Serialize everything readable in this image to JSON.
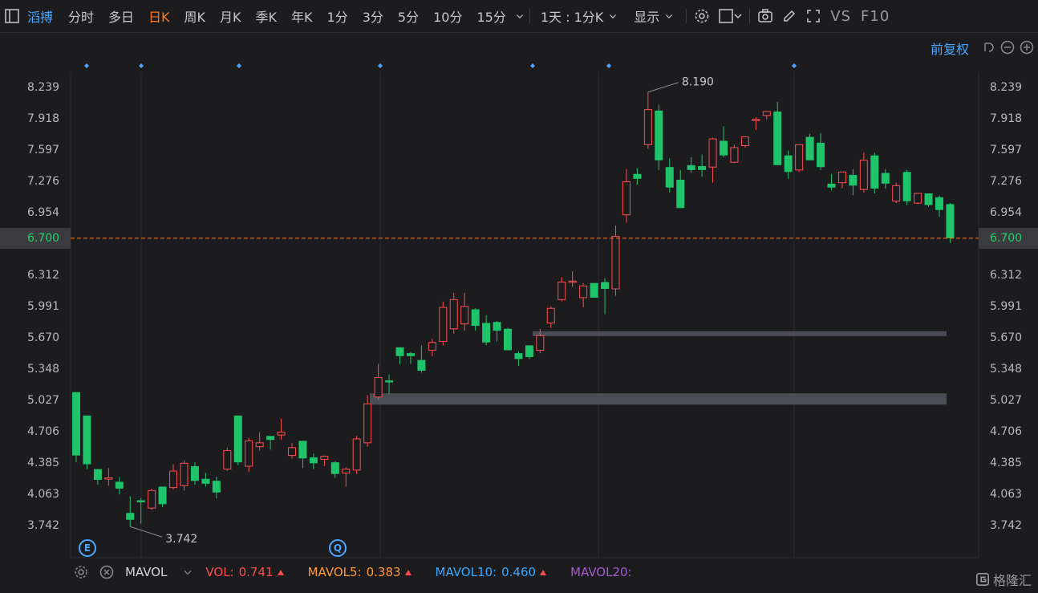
{
  "toolbar": {
    "stock_name": "滔搏",
    "periods": [
      "分时",
      "多日",
      "日K",
      "周K",
      "月K",
      "季K",
      "年K",
      "1分",
      "3分",
      "5分",
      "10分",
      "15分"
    ],
    "active_period": "日K",
    "range_select": "1天 : 1分K",
    "display_label": "显示",
    "vs_label": "VS",
    "f10_label": "F10"
  },
  "header": {
    "restore_label": "前复权"
  },
  "price_axis": {
    "ticks": [
      "8.239",
      "7.918",
      "7.597",
      "7.276",
      "6.954",
      "6.700",
      "6.312",
      "5.991",
      "5.670",
      "5.348",
      "5.027",
      "4.706",
      "4.385",
      "4.063",
      "3.742"
    ],
    "current_price": "6.700"
  },
  "annotations": {
    "high_label": "8.190",
    "low_label": "3.742",
    "event_e": "E",
    "event_q": "Q"
  },
  "indicators": {
    "name": "MAVOL",
    "vol_label": "VOL:",
    "vol_value": "0.741",
    "ma5_label": "MAVOL5:",
    "ma5_value": "0.383",
    "ma10_label": "MAVOL10:",
    "ma10_value": "0.460",
    "ma20_label": "MAVOL20:"
  },
  "colors": {
    "up": "#ff4d4f",
    "down": "#1fc46a",
    "accent": "#ff7a1a",
    "link": "#4da6ff"
  },
  "watermark": "格隆汇",
  "chart_data": {
    "type": "candlestick",
    "ylim": [
      3.742,
      8.239
    ],
    "current_price": 6.7,
    "high": 8.19,
    "low": 3.742,
    "candles": [
      {
        "o": 5.12,
        "h": 5.12,
        "c": 4.47,
        "l": 4.4
      },
      {
        "o": 4.88,
        "h": 4.88,
        "c": 4.38,
        "l": 4.33
      },
      {
        "o": 4.33,
        "h": 4.33,
        "c": 4.22,
        "l": 4.17
      },
      {
        "o": 4.24,
        "h": 4.34,
        "c": 4.24,
        "l": 4.16
      },
      {
        "o": 4.2,
        "h": 4.25,
        "c": 4.13,
        "l": 4.07
      },
      {
        "o": 3.88,
        "h": 4.05,
        "c": 3.81,
        "l": 3.74
      },
      {
        "o": 4.01,
        "h": 4.03,
        "c": 3.99,
        "l": 3.77
      },
      {
        "o": 3.93,
        "h": 4.13,
        "c": 4.11,
        "l": 3.91
      },
      {
        "o": 4.15,
        "h": 4.15,
        "c": 3.97,
        "l": 3.94
      },
      {
        "o": 4.14,
        "h": 4.38,
        "c": 4.31,
        "l": 4.12
      },
      {
        "o": 4.16,
        "h": 4.42,
        "c": 4.39,
        "l": 4.11
      },
      {
        "o": 4.36,
        "h": 4.4,
        "c": 4.21,
        "l": 4.17
      },
      {
        "o": 4.23,
        "h": 4.29,
        "c": 4.18,
        "l": 4.15
      },
      {
        "o": 4.21,
        "h": 4.25,
        "c": 4.09,
        "l": 4.03
      },
      {
        "o": 4.33,
        "h": 4.55,
        "c": 4.52,
        "l": 4.31
      },
      {
        "o": 4.88,
        "h": 4.88,
        "c": 4.4,
        "l": 4.37
      },
      {
        "o": 4.36,
        "h": 4.65,
        "c": 4.62,
        "l": 4.3
      },
      {
        "o": 4.56,
        "h": 4.71,
        "c": 4.6,
        "l": 4.52
      },
      {
        "o": 4.67,
        "h": 4.67,
        "c": 4.63,
        "l": 4.53
      },
      {
        "o": 4.68,
        "h": 4.85,
        "c": 4.71,
        "l": 4.63
      },
      {
        "o": 4.47,
        "h": 4.6,
        "c": 4.55,
        "l": 4.44
      },
      {
        "o": 4.62,
        "h": 4.62,
        "c": 4.44,
        "l": 4.34
      },
      {
        "o": 4.45,
        "h": 4.49,
        "c": 4.39,
        "l": 4.33
      },
      {
        "o": 4.43,
        "h": 4.47,
        "c": 4.46,
        "l": 4.36
      },
      {
        "o": 4.4,
        "h": 4.41,
        "c": 4.28,
        "l": 4.24
      },
      {
        "o": 4.29,
        "h": 4.35,
        "c": 4.33,
        "l": 4.15
      },
      {
        "o": 4.32,
        "h": 4.67,
        "c": 4.64,
        "l": 4.28
      },
      {
        "o": 4.6,
        "h": 5.09,
        "c": 5.0,
        "l": 4.56
      },
      {
        "o": 5.07,
        "h": 5.41,
        "c": 5.27,
        "l": 5.04
      },
      {
        "o": 5.24,
        "h": 5.3,
        "c": 5.22,
        "l": 5.1
      },
      {
        "o": 5.58,
        "h": 5.58,
        "c": 5.49,
        "l": 5.41
      },
      {
        "o": 5.52,
        "h": 5.53,
        "c": 5.49,
        "l": 5.41
      },
      {
        "o": 5.45,
        "h": 5.6,
        "c": 5.34,
        "l": 5.32
      },
      {
        "o": 5.55,
        "h": 5.67,
        "c": 5.63,
        "l": 5.49
      },
      {
        "o": 5.64,
        "h": 6.05,
        "c": 5.99,
        "l": 5.6
      },
      {
        "o": 5.77,
        "h": 6.14,
        "c": 6.07,
        "l": 5.72
      },
      {
        "o": 5.82,
        "h": 6.14,
        "c": 6.0,
        "l": 5.75
      },
      {
        "o": 5.97,
        "h": 5.98,
        "c": 5.8,
        "l": 5.75
      },
      {
        "o": 5.83,
        "h": 5.91,
        "c": 5.63,
        "l": 5.6
      },
      {
        "o": 5.84,
        "h": 5.85,
        "c": 5.75,
        "l": 5.64
      },
      {
        "o": 5.77,
        "h": 5.78,
        "c": 5.55,
        "l": 5.55
      },
      {
        "o": 5.52,
        "h": 5.54,
        "c": 5.46,
        "l": 5.39
      },
      {
        "o": 5.6,
        "h": 5.6,
        "c": 5.48,
        "l": 5.46
      },
      {
        "o": 5.55,
        "h": 5.77,
        "c": 5.7,
        "l": 5.52
      },
      {
        "o": 5.83,
        "h": 6.0,
        "c": 5.98,
        "l": 5.78
      },
      {
        "o": 6.07,
        "h": 6.3,
        "c": 6.25,
        "l": 6.05
      },
      {
        "o": 6.26,
        "h": 6.36,
        "c": 6.26,
        "l": 6.2
      },
      {
        "o": 6.09,
        "h": 6.24,
        "c": 6.21,
        "l": 5.99
      },
      {
        "o": 6.24,
        "h": 6.24,
        "c": 6.09,
        "l": 6.09
      },
      {
        "o": 6.25,
        "h": 6.29,
        "c": 6.18,
        "l": 5.92
      },
      {
        "o": 6.18,
        "h": 6.83,
        "c": 6.72,
        "l": 6.11
      },
      {
        "o": 6.94,
        "h": 7.41,
        "c": 7.28,
        "l": 6.86
      },
      {
        "o": 7.36,
        "h": 7.42,
        "c": 7.31,
        "l": 7.25
      },
      {
        "o": 7.66,
        "h": 8.2,
        "c": 8.02,
        "l": 7.62
      },
      {
        "o": 8.01,
        "h": 8.07,
        "c": 7.5,
        "l": 7.4
      },
      {
        "o": 7.43,
        "h": 7.52,
        "c": 7.22,
        "l": 7.17
      },
      {
        "o": 7.3,
        "h": 7.4,
        "c": 7.01,
        "l": 7.01
      },
      {
        "o": 7.45,
        "h": 7.53,
        "c": 7.4,
        "l": 7.37
      },
      {
        "o": 7.44,
        "h": 7.56,
        "c": 7.4,
        "l": 7.33
      },
      {
        "o": 7.43,
        "h": 7.73,
        "c": 7.72,
        "l": 7.27
      },
      {
        "o": 7.7,
        "h": 7.85,
        "c": 7.55,
        "l": 7.53
      },
      {
        "o": 7.48,
        "h": 7.66,
        "c": 7.63,
        "l": 7.47
      },
      {
        "o": 7.65,
        "h": 7.71,
        "c": 7.74,
        "l": 7.63
      },
      {
        "o": 7.91,
        "h": 7.94,
        "c": 7.92,
        "l": 7.81
      },
      {
        "o": 7.96,
        "h": 8.0,
        "c": 8.0,
        "l": 7.92
      },
      {
        "o": 8.0,
        "h": 8.1,
        "c": 7.45,
        "l": 7.45
      },
      {
        "o": 7.55,
        "h": 7.6,
        "c": 7.38,
        "l": 7.31
      },
      {
        "o": 7.4,
        "h": 7.66,
        "c": 7.66,
        "l": 7.38
      },
      {
        "o": 7.74,
        "h": 7.77,
        "c": 7.5,
        "l": 7.5
      },
      {
        "o": 7.68,
        "h": 7.78,
        "c": 7.43,
        "l": 7.4
      },
      {
        "o": 7.26,
        "h": 7.36,
        "c": 7.22,
        "l": 7.19
      },
      {
        "o": 7.27,
        "h": 7.38,
        "c": 7.38,
        "l": 7.21
      },
      {
        "o": 7.35,
        "h": 7.41,
        "c": 7.24,
        "l": 7.14
      },
      {
        "o": 7.2,
        "h": 7.58,
        "c": 7.5,
        "l": 7.17
      },
      {
        "o": 7.55,
        "h": 7.58,
        "c": 7.21,
        "l": 7.16
      },
      {
        "o": 7.37,
        "h": 7.41,
        "c": 7.26,
        "l": 7.21
      },
      {
        "o": 7.08,
        "h": 7.27,
        "c": 7.24,
        "l": 7.06
      },
      {
        "o": 7.38,
        "h": 7.4,
        "c": 7.08,
        "l": 7.04
      },
      {
        "o": 7.06,
        "h": 7.14,
        "c": 7.16,
        "l": 7.05
      },
      {
        "o": 7.16,
        "h": 7.16,
        "c": 7.04,
        "l": 7.02
      },
      {
        "o": 7.12,
        "h": 7.14,
        "c": 6.99,
        "l": 6.92
      },
      {
        "o": 7.05,
        "h": 7.06,
        "c": 6.7,
        "l": 6.65
      }
    ],
    "support_levels": [
      5.72,
      5.05
    ]
  }
}
